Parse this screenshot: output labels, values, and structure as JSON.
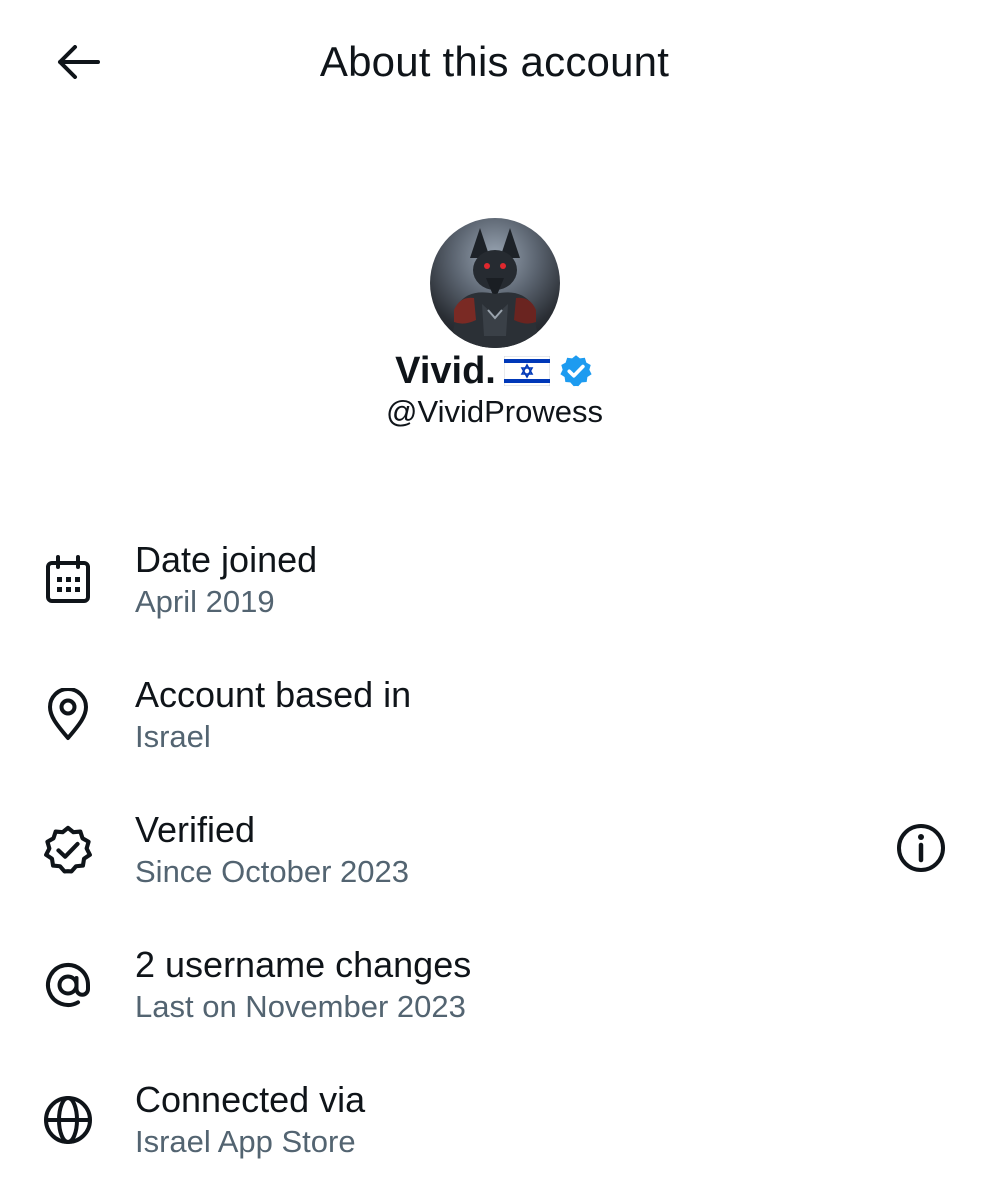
{
  "header": {
    "title": "About this account",
    "back_icon": "arrow-left-icon"
  },
  "profile": {
    "display_name": "Vivid.",
    "flag_icon": "israel-flag-icon",
    "verified_icon": "verified-badge-icon",
    "handle": "@VividProwess",
    "accent_color": "#1d9bf0"
  },
  "details": [
    {
      "icon": "calendar-icon",
      "label": "Date joined",
      "value": "April 2019"
    },
    {
      "icon": "location-pin-icon",
      "label": "Account based in",
      "value": "Israel"
    },
    {
      "icon": "verified-outline-icon",
      "label": "Verified",
      "value": "Since October 2023",
      "action_icon": "info-icon"
    },
    {
      "icon": "at-sign-icon",
      "label": "2 username changes",
      "value": "Last on November 2023"
    },
    {
      "icon": "globe-icon",
      "label": "Connected via",
      "value": "Israel App Store"
    }
  ],
  "colors": {
    "text_primary": "#0f1419",
    "text_secondary": "#536471",
    "verified_blue": "#1d9bf0",
    "flag_blue": "#0038b8"
  }
}
